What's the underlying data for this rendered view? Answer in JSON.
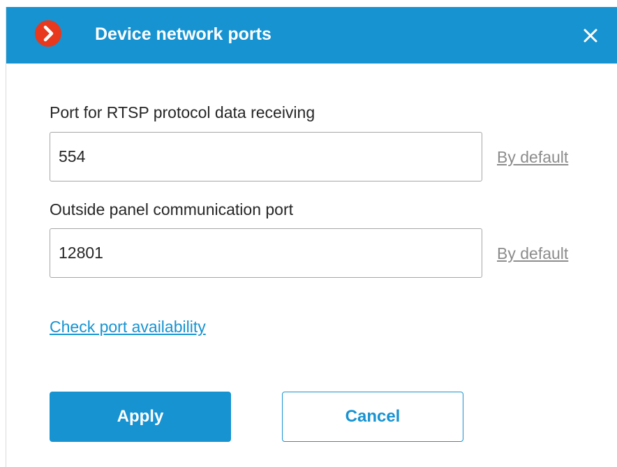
{
  "dialog": {
    "title": "Device network ports",
    "logo_icon": "arrow-right-circle-icon",
    "close_icon": "close-icon",
    "accent_color": "#1793d1",
    "logo_color": "#e8381d"
  },
  "fields": [
    {
      "label": "Port for RTSP protocol data receiving",
      "value": "554",
      "default_link": "By default"
    },
    {
      "label": "Outside panel communication port",
      "value": "12801",
      "default_link": "By default"
    }
  ],
  "check_link": "Check port availability",
  "buttons": {
    "apply": "Apply",
    "cancel": "Cancel"
  }
}
